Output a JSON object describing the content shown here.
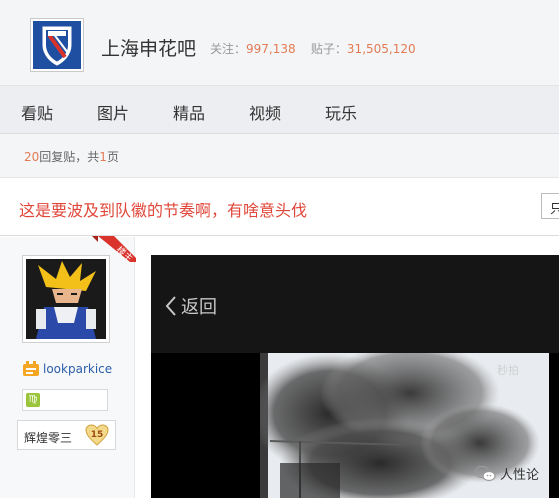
{
  "forum": {
    "name": "上海申花吧",
    "follow_label": "关注：",
    "follow_count": "997,138",
    "posts_label": "贴子：",
    "posts_count": "31,505,120"
  },
  "tabs": [
    {
      "label": "看贴"
    },
    {
      "label": "图片"
    },
    {
      "label": "精品"
    },
    {
      "label": "视频"
    },
    {
      "label": "玩乐"
    }
  ],
  "reply_info": {
    "count": "20",
    "count_suffix": "回复贴，共",
    "pages": "1",
    "pages_suffix": "页"
  },
  "thread": {
    "title": "这是要波及到队徽的节奏啊，有啥意头伐",
    "action_label": "只"
  },
  "author": {
    "badge": "楼主",
    "username": "lookparkice",
    "level_name": "辉煌零三",
    "level": "15"
  },
  "video": {
    "back_label": "返回",
    "watermark": "秒拍"
  },
  "watermark": {
    "label": "人性论"
  },
  "colors": {
    "accent_orange": "#e27b55",
    "title_red": "#e0473a",
    "badge_red": "#d9332b",
    "link_blue": "#2a5ea8",
    "logo_blue": "#1f4fa0"
  },
  "icons": {
    "logo": "shenhua-crest-icon",
    "back": "chevron-left-icon",
    "level": "heart-badge-icon",
    "zodiac": "zodiac-virgo-icon",
    "wechat": "wechat-icon"
  }
}
